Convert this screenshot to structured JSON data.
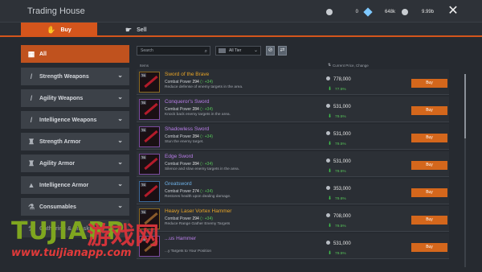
{
  "window": {
    "title": "Trading House",
    "close_icon": "close-icon"
  },
  "currencies": [
    {
      "icon": "silver-coin-icon",
      "amount": "0",
      "color": "#c8ccd1"
    },
    {
      "icon": "gem-icon",
      "amount": "648k",
      "color": "#7ec8ff"
    },
    {
      "icon": "gold-coin-icon",
      "amount": "9.99b",
      "color": "#c8ccd1"
    }
  ],
  "tabs": [
    {
      "label": "Buy",
      "icon": "hand-coins-icon",
      "active": true
    },
    {
      "label": "Sell",
      "icon": "hand-icon",
      "active": false
    }
  ],
  "categories": [
    {
      "label": "All",
      "icon": "grid-icon",
      "active": true
    },
    {
      "label": "Strength Weapons",
      "icon": "sword-icon"
    },
    {
      "label": "Agility Weapons",
      "icon": "dagger-icon"
    },
    {
      "label": "Intelligence Weapons",
      "icon": "staff-icon"
    },
    {
      "label": "Strength Armor",
      "icon": "heavy-armor-icon"
    },
    {
      "label": "Agility Armor",
      "icon": "light-armor-icon"
    },
    {
      "label": "Intelligence Armor",
      "icon": "robe-icon"
    },
    {
      "label": "Consumables",
      "icon": "potion-icon"
    },
    {
      "label": "Gathering & Lifeskill...",
      "icon": "pickaxe-icon"
    }
  ],
  "filters": {
    "search_placeholder": "Search",
    "tier_value": "All Tier",
    "reset_icon": "reset-icon",
    "refresh_icon": "refresh-icon"
  },
  "columns": {
    "items": "Items",
    "price": "Current Price, Change"
  },
  "items": [
    {
      "name": "Sword of the Brave",
      "rarity": "gold",
      "power_label": "Combat Power",
      "power": "294",
      "delta": "(↑ +34)",
      "desc": "Reduce defense of enemy targets in the area.",
      "price": "778,000",
      "change": "77.5%",
      "buy": "Buy"
    },
    {
      "name": "Conqueror's Sword",
      "rarity": "purple",
      "power_label": "Combat Power",
      "power": "284",
      "delta": "(↑ +34)",
      "desc": "Knock back enemy targets in the area.",
      "price": "531,000",
      "change": "79.5%",
      "buy": "Buy"
    },
    {
      "name": "Shadowless Sword",
      "rarity": "purple",
      "power_label": "Combat Power",
      "power": "284",
      "delta": "(↑ +34)",
      "desc": "Stun the enemy target.",
      "price": "531,000",
      "change": "79.5%",
      "buy": "Buy"
    },
    {
      "name": "Edge Sword",
      "rarity": "purple",
      "power_label": "Combat Power",
      "power": "284",
      "delta": "(↑ +34)",
      "desc": "Silence and slow enemy targets in the area.",
      "price": "531,000",
      "change": "79.5%",
      "buy": "Buy"
    },
    {
      "name": "Greatsword",
      "rarity": "blue",
      "power_label": "Combat Power",
      "power": "274",
      "delta": "(↑ +34)",
      "desc": "Restores health upon dealing damage.",
      "price": "353,000",
      "change": "79.6%",
      "buy": "Buy"
    },
    {
      "name": "Heavy Laser Vortex Hammer",
      "rarity": "gold",
      "power_label": "Combat Power",
      "power": "294",
      "delta": "(↑ +34)",
      "desc": "Reduce Range Gather Enemy Targets",
      "price": "708,000",
      "change": "79.5%",
      "buy": "Buy"
    },
    {
      "name": "...us Hammer",
      "rarity": "purple",
      "power_label": "",
      "power": "",
      "delta": "",
      "desc": "...y Targets to Your Position",
      "price": "531,000",
      "change": "79.5%",
      "buy": "Buy"
    }
  ],
  "watermark": {
    "brand": "TUJIAPP",
    "cn": "游戏网",
    "url": "www.tuijianapp.com"
  }
}
